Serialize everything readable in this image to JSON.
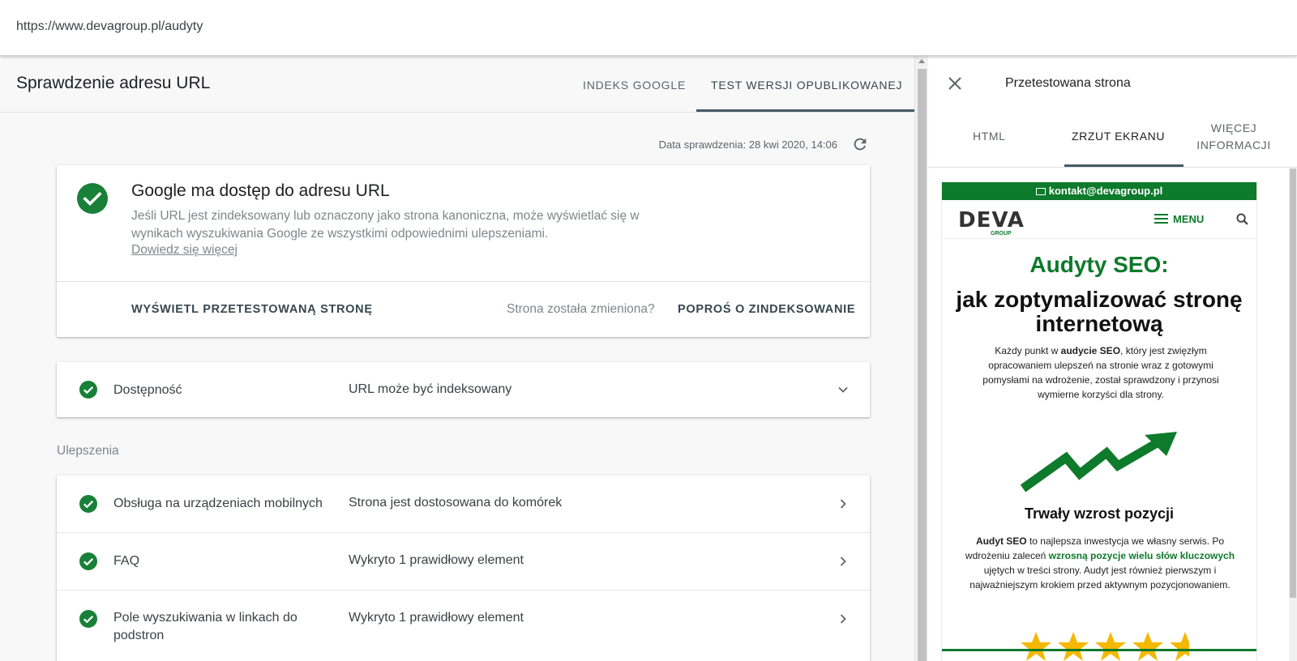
{
  "browser": {
    "url": "https://www.devagroup.pl/audyty"
  },
  "header": {
    "title": "Sprawdzenie adresu URL",
    "tabs": [
      {
        "label": "INDEKS GOOGLE",
        "active": false
      },
      {
        "label": "TEST WERSJI OPUBLIKOWANEJ",
        "active": true
      }
    ]
  },
  "check": {
    "date_text": "Data sprawdzenia: 28 kwi 2020, 14:06"
  },
  "summary": {
    "heading": "Google ma dostęp do adresu URL",
    "description": "Jeśli URL jest zindeksowany lub oznaczony jako strona kanoniczna, może wyświetlać się w wynikach wyszukiwania Google ze wszystkimi odpowiednimi ulepszeniami.",
    "learn_more": "Dowiedz się więcej",
    "view_button": "WYŚWIETL PRZETESTOWANĄ STRONĘ",
    "changed_text": "Strona została zmieniona?",
    "request_button": "POPROŚ O ZINDEKSOWANIE"
  },
  "availability": {
    "label": "Dostępność",
    "value": "URL może być indeksowany"
  },
  "enhancements": {
    "section_label": "Ulepszenia",
    "rows": [
      {
        "label": "Obsługa na urządzeniach mobilnych",
        "value": "Strona jest dostosowana do komórek"
      },
      {
        "label": "FAQ",
        "value": "Wykryto 1 prawidłowy element"
      },
      {
        "label": "Pole wyszukiwania w linkach do podstron",
        "value": "Wykryto 1 prawidłowy element"
      }
    ]
  },
  "panel": {
    "title": "Przetestowana strona",
    "tabs": [
      {
        "label": "HTML",
        "active": false
      },
      {
        "label": "ZRZUT EKRANU",
        "active": true
      },
      {
        "label": "WIĘCEJ INFORMACJI",
        "active": false
      }
    ]
  },
  "preview": {
    "email": "kontakt@devagroup.pl",
    "logo": "DEVA",
    "logo_sub": "GROUP",
    "menu_label": "MENU",
    "h1": "Audyty SEO:",
    "h2": "jak zoptymalizować stronę internetową",
    "p1_before": "Każdy punkt w ",
    "p1_bold": "audycie SEO",
    "p1_after": ", który jest zwięzłym opracowaniem ulepszeń na stronie wraz z gotowymi pomysłami na wdrożenie, został sprawdzony i przynosi wymierne korzyści dla strony.",
    "h3": "Trwały wzrost pozycji",
    "p2_bold": "Audyt SEO",
    "p2_mid": " to najlepsza inwestycja we własny serwis. Po wdrożeniu zaleceń ",
    "p2_green": "wzrosną pozycje wielu słów kluczowych",
    "p2_after": " ujętych w treści strony. Audyt jest również pierwszym i najważniejszym krokiem przed aktywnym pozycjonowaniem."
  },
  "colors": {
    "accent_green": "#0e7a2c",
    "google_green": "#188038",
    "tab_active": "#455a64"
  }
}
